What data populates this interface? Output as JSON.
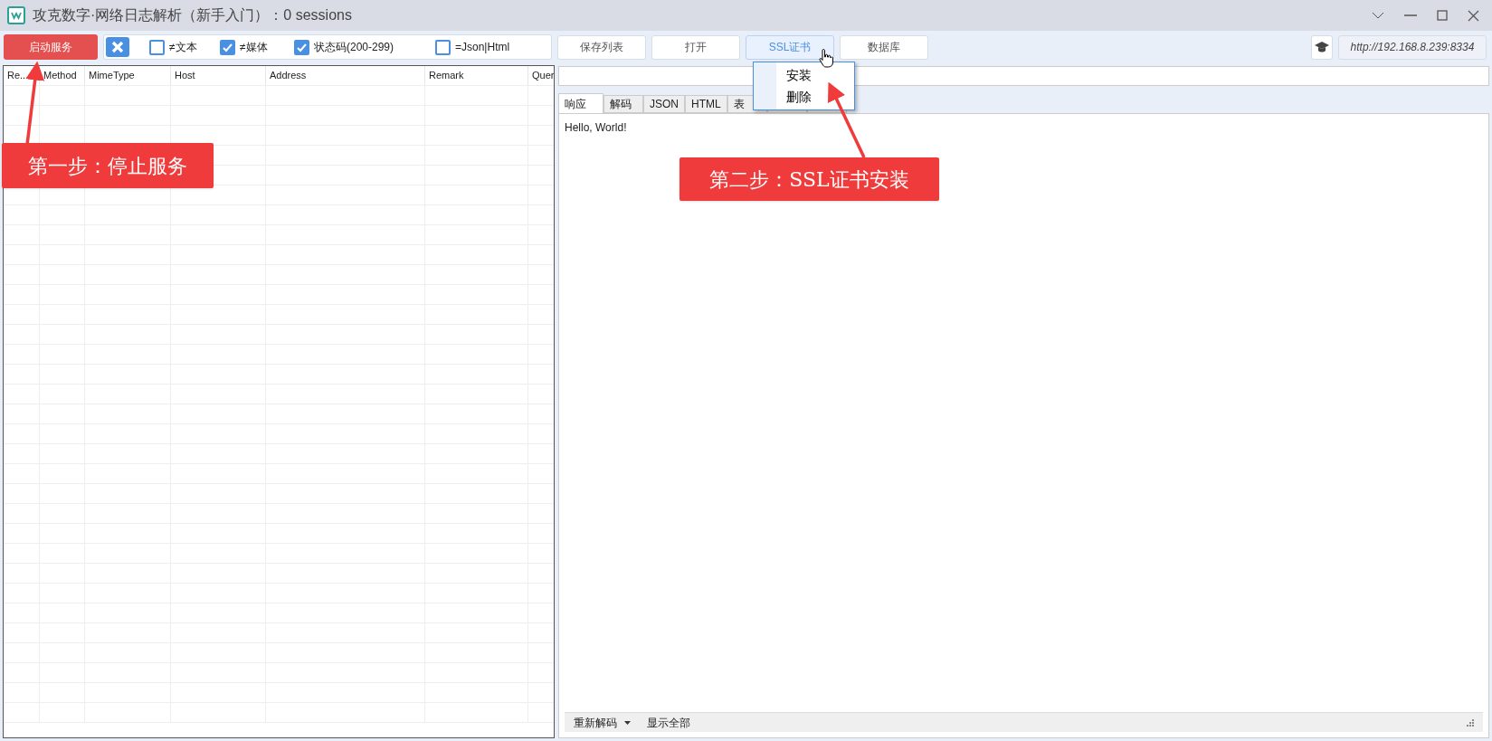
{
  "window": {
    "title": "攻克数字·网络日志解析（新手入门）：0 sessions"
  },
  "toolbar": {
    "start_button": "启动服务",
    "filters": [
      {
        "label": "≠文本",
        "checked": false
      },
      {
        "label": "≠媒体",
        "checked": true
      },
      {
        "label": "状态码(200-299)",
        "checked": true
      },
      {
        "label": "=Json|Html",
        "checked": false
      }
    ],
    "buttons": [
      {
        "label": "保存列表",
        "active": false
      },
      {
        "label": "打开",
        "active": false
      },
      {
        "label": "SSL证书",
        "active": true
      },
      {
        "label": "数据库",
        "active": false
      }
    ],
    "url": "http://192.168.8.239:8334"
  },
  "ssl_menu": {
    "items": [
      "安装",
      "删除"
    ]
  },
  "table": {
    "columns": [
      "Re...",
      "Method",
      "MimeType",
      "Host",
      "Address",
      "Remark",
      "Quer"
    ]
  },
  "detail": {
    "tabs": [
      {
        "label": "响应",
        "selected": true
      },
      {
        "label": "解码",
        "selected": false
      },
      {
        "label": "JSON",
        "selected": false
      },
      {
        "label": "HTML",
        "selected": false
      },
      {
        "label": "表",
        "selected": false
      }
    ],
    "body": "Hello, World!",
    "footer": {
      "decode_button": "重新解码",
      "show_all_button": "显示全部"
    }
  },
  "annotations": [
    {
      "text": "第一步：停止服务"
    },
    {
      "text": "第二步：SSL证书安装"
    }
  ]
}
